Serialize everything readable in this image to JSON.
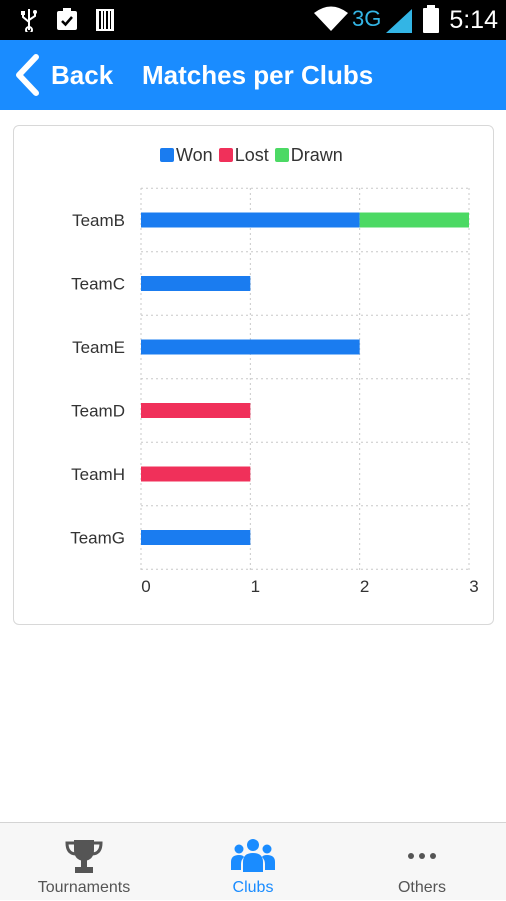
{
  "status_bar": {
    "time": "5:14",
    "network": "3G"
  },
  "app_bar": {
    "back_label": "Back",
    "title": "Matches per Clubs"
  },
  "colors": {
    "primary": "#1a8cff",
    "won": "#1a7cf0",
    "lost": "#f0305a",
    "drawn": "#4cd964"
  },
  "chart_data": {
    "type": "bar",
    "orientation": "horizontal",
    "stacked": true,
    "categories": [
      "TeamB",
      "TeamC",
      "TeamE",
      "TeamD",
      "TeamH",
      "TeamG"
    ],
    "series": [
      {
        "name": "Won",
        "values": [
          2,
          1,
          2,
          0,
          0,
          1
        ]
      },
      {
        "name": "Lost",
        "values": [
          0,
          0,
          0,
          1,
          1,
          0
        ]
      },
      {
        "name": "Drawn",
        "values": [
          1,
          0,
          0,
          0,
          0,
          0
        ]
      }
    ],
    "xlim": [
      0,
      3
    ],
    "xticks": [
      "0",
      "1",
      "2",
      "3"
    ],
    "grid": true,
    "legend": "top"
  },
  "bottom_nav": {
    "items": [
      {
        "label": "Tournaments",
        "icon": "trophy-icon"
      },
      {
        "label": "Clubs",
        "icon": "group-icon",
        "active": true
      },
      {
        "label": "Others",
        "icon": "more-icon"
      }
    ]
  }
}
